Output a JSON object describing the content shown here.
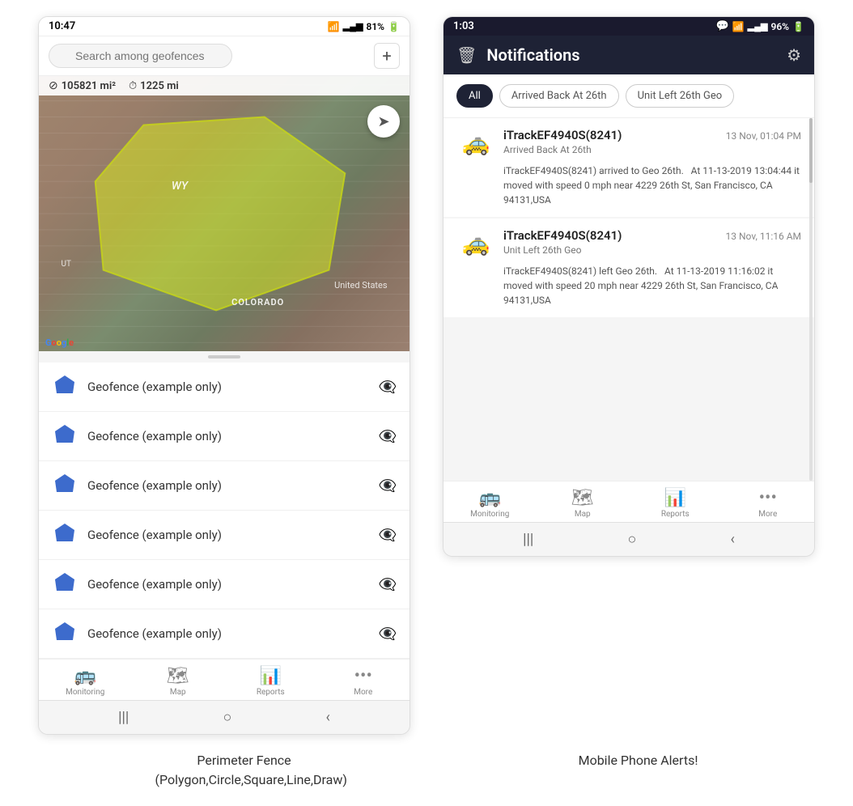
{
  "left_phone": {
    "status_bar": {
      "time": "10:47",
      "battery": "81%",
      "signal": "WiFi+LTE"
    },
    "search": {
      "placeholder": "Search among geofences"
    },
    "map_stats": {
      "area": "105821 mi²",
      "distance": "1225 mi"
    },
    "map_labels": {
      "wy": "WY",
      "colorado": "COLORADO",
      "ut": "UT",
      "united_states": "United States"
    },
    "geofence_items": [
      {
        "name": "Geofence (example only)"
      },
      {
        "name": "Geofence (example only)"
      },
      {
        "name": "Geofence (example only)"
      },
      {
        "name": "Geofence (example only)"
      },
      {
        "name": "Geofence (example only)"
      },
      {
        "name": "Geofence (example only)"
      }
    ],
    "bottom_nav": [
      {
        "label": "Monitoring",
        "icon": "🚌"
      },
      {
        "label": "Map",
        "icon": "🗺"
      },
      {
        "label": "Reports",
        "icon": "📊"
      },
      {
        "label": "More",
        "icon": "···"
      }
    ],
    "android_nav": [
      "|||",
      "○",
      "‹"
    ]
  },
  "right_phone": {
    "status_bar": {
      "time": "1:03",
      "battery": "96%"
    },
    "header": {
      "title": "Notifications",
      "delete_icon": "🗑",
      "settings_icon": "⚙"
    },
    "filter_tabs": [
      {
        "label": "All",
        "active": true
      },
      {
        "label": "Arrived Back At 26th",
        "active": false
      },
      {
        "label": "Unit Left 26th Geo",
        "active": false
      }
    ],
    "notifications": [
      {
        "device": "iTrackEF4940S(8241)",
        "time": "13 Nov, 01:04 PM",
        "event": "Arrived Back At 26th",
        "body": "iTrackEF4940S(8241) arrived to Geo 26th.    At 11-13-2019 13:04:44 it moved with speed 0 mph near 4229 26th St, San Francisco, CA 94131,USA",
        "car_emoji": "🚕"
      },
      {
        "device": "iTrackEF4940S(8241)",
        "time": "13 Nov, 11:16 AM",
        "event": "Unit Left 26th Geo",
        "body": "iTrackEF4940S(8241) left Geo 26th.    At 11-13-2019 11:16:02 it moved with speed 20 mph near 4229 26th St, San Francisco, CA 94131,USA",
        "car_emoji": "🚕"
      }
    ],
    "bottom_nav": [
      {
        "label": "Monitoring",
        "icon": "🚌"
      },
      {
        "label": "Map",
        "icon": "🗺"
      },
      {
        "label": "Reports",
        "icon": "📊"
      },
      {
        "label": "More",
        "icon": "···"
      }
    ],
    "android_nav": [
      "|||",
      "○",
      "‹"
    ]
  },
  "captions": {
    "left": "Perimeter Fence\n(Polygon,Circle,Square,Line,Draw)",
    "right": "Mobile Phone Alerts!"
  },
  "colors": {
    "dark_header": "#1e2235",
    "accent_blue": "#3b6de8",
    "geofence_blue": "#3d6bcc",
    "yellow_poly": "rgba(230, 240, 50, 0.55)"
  }
}
